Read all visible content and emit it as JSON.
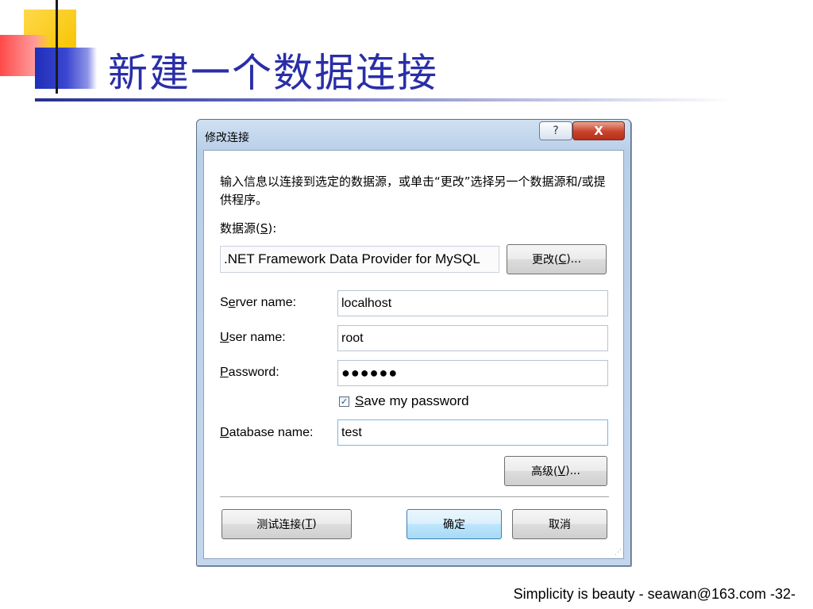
{
  "slide": {
    "title": "新建一个数据连接",
    "footer": "Simplicity is beauty - seawan@163.com   -32-"
  },
  "dialog": {
    "title": "修改连接",
    "help_symbol": "?",
    "close_symbol": "X",
    "description": "输入信息以连接到选定的数据源，或单击“更改”选择另一个数据源和/或提供程序。",
    "datasource_label_prefix": "数据源(",
    "datasource_label_key": "S",
    "datasource_label_suffix": "):",
    "datasource_value": ".NET Framework Data Provider for MySQL",
    "change_button_prefix": "更改(",
    "change_button_key": "C",
    "change_button_suffix": ")...",
    "server_label_pre": "S",
    "server_label_key": "e",
    "server_label_post": "rver name:",
    "server_value": "localhost",
    "user_label_key": "U",
    "user_label_post": "ser name:",
    "user_value": "root",
    "password_label_key": "P",
    "password_label_post": "assword:",
    "password_value": "●●●●●●",
    "save_password_checked": true,
    "save_password_key": "S",
    "save_password_post": "ave my password",
    "database_label_key": "D",
    "database_label_post": "atabase name:",
    "database_value": "test",
    "advanced_button_prefix": "高级(",
    "advanced_button_key": "V",
    "advanced_button_suffix": ")...",
    "test_button_prefix": "测试连接(",
    "test_button_key": "T",
    "test_button_suffix": ")",
    "ok_button": "确定",
    "cancel_button": "取消"
  },
  "colors": {
    "title_blue": "#2a2ea8",
    "accent_yellow": "#f7c400",
    "accent_red": "#ff4a4a",
    "accent_blue": "#1f2fb8",
    "close_red": "#c9422b"
  }
}
